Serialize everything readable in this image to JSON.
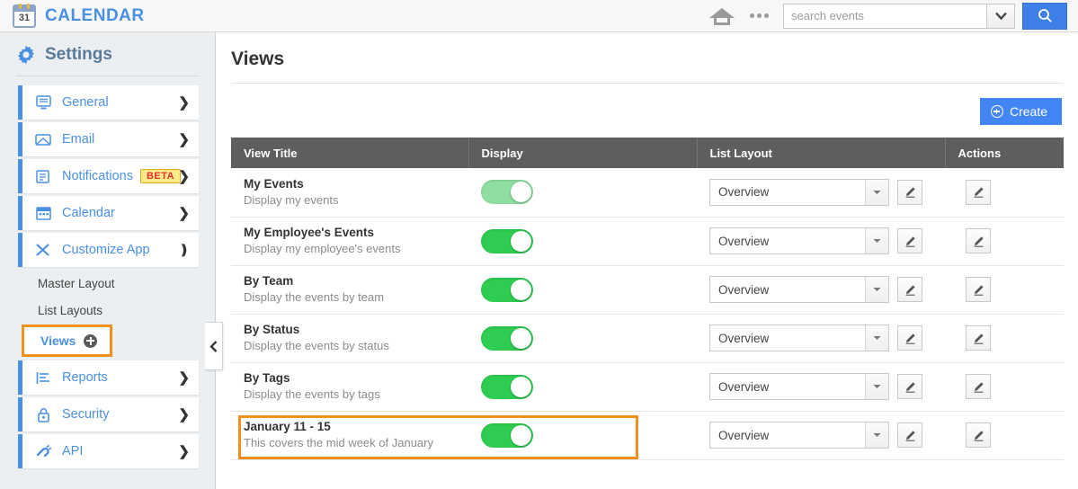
{
  "header": {
    "brand_title": "CALENDAR",
    "calendar_icon_day": "31",
    "home_icon": "home-icon",
    "more_icon": "ellipsis-icon",
    "search_placeholder": "search events",
    "search_value": "",
    "search_button_icon": "search-icon",
    "dropdown_icon": "chevron-down-icon"
  },
  "sidebar": {
    "title": "Settings",
    "gear_icon": "gear-icon",
    "items": [
      {
        "label": "General",
        "icon": "monitor-icon",
        "chevron": "chevron-right-icon",
        "badge": null
      },
      {
        "label": "Email",
        "icon": "envelope-icon",
        "chevron": "chevron-right-icon",
        "badge": null
      },
      {
        "label": "Notifications",
        "icon": "notification-list-icon",
        "chevron": "chevron-right-icon",
        "badge": "BETA"
      },
      {
        "label": "Calendar",
        "icon": "calendar-icon",
        "chevron": "chevron-right-icon",
        "badge": null
      },
      {
        "label": "Customize App",
        "icon": "tools-icon",
        "chevron": "chevron-down-icon",
        "badge": null
      }
    ],
    "sub_items": [
      {
        "label": "Master Layout",
        "highlighted": false,
        "plus_icon": null
      },
      {
        "label": "List Layouts",
        "highlighted": false,
        "plus_icon": null
      },
      {
        "label": "Views",
        "highlighted": true,
        "plus_icon": "plus-circle-icon"
      }
    ],
    "items_after": [
      {
        "label": "Reports",
        "icon": "chart-bars-icon",
        "chevron": "chevron-right-icon",
        "badge": null
      },
      {
        "label": "Security",
        "icon": "lock-icon",
        "chevron": "chevron-right-icon",
        "badge": null
      },
      {
        "label": "API",
        "icon": "plug-icon",
        "chevron": "chevron-right-icon",
        "badge": null
      }
    ],
    "collapse_icon": "chevron-left-icon"
  },
  "main": {
    "page_title": "Views",
    "create_label": "Create",
    "create_icon": "plus-circle-icon",
    "table": {
      "columns": [
        "View Title",
        "Display",
        "List Layout",
        "Actions"
      ],
      "rows": [
        {
          "title": "My Events",
          "description": "Display my events",
          "display_on": true,
          "toggle_state": "on-light",
          "list_layout": "Overview",
          "layout_edit_icon": "pencil-icon",
          "action_edit_icon": "pencil-icon",
          "highlighted": false
        },
        {
          "title": "My Employee's Events",
          "description": "Display my employee's events",
          "display_on": true,
          "toggle_state": "on",
          "list_layout": "Overview",
          "layout_edit_icon": "pencil-icon",
          "action_edit_icon": "pencil-icon",
          "highlighted": false
        },
        {
          "title": "By Team",
          "description": "Display the events by team",
          "display_on": true,
          "toggle_state": "on",
          "list_layout": "Overview",
          "layout_edit_icon": "pencil-icon",
          "action_edit_icon": "pencil-icon",
          "highlighted": false
        },
        {
          "title": "By Status",
          "description": "Display the events by status",
          "display_on": true,
          "toggle_state": "on",
          "list_layout": "Overview",
          "layout_edit_icon": "pencil-icon",
          "action_edit_icon": "pencil-icon",
          "highlighted": false
        },
        {
          "title": "By Tags",
          "description": "Display the events by tags",
          "display_on": true,
          "toggle_state": "on",
          "list_layout": "Overview",
          "layout_edit_icon": "pencil-icon",
          "action_edit_icon": "pencil-icon",
          "highlighted": false
        },
        {
          "title": "January 11 - 15",
          "description": "This covers the mid week of January",
          "display_on": true,
          "toggle_state": "on",
          "list_layout": "Overview",
          "layout_edit_icon": "pencil-icon",
          "action_edit_icon": "pencil-icon",
          "highlighted": true
        }
      ]
    }
  },
  "colors": {
    "brand_blue": "#4a90e2",
    "accent_blue": "#4285f4",
    "toggle_green": "#2ecc52",
    "toggle_green_light": "#8ede9f",
    "highlight_orange": "#f0901e",
    "table_header_gray": "#5e5e5e",
    "sidebar_bg": "#eceff1",
    "beta_badge_bg": "#fbec88",
    "beta_badge_text": "#e33030"
  }
}
